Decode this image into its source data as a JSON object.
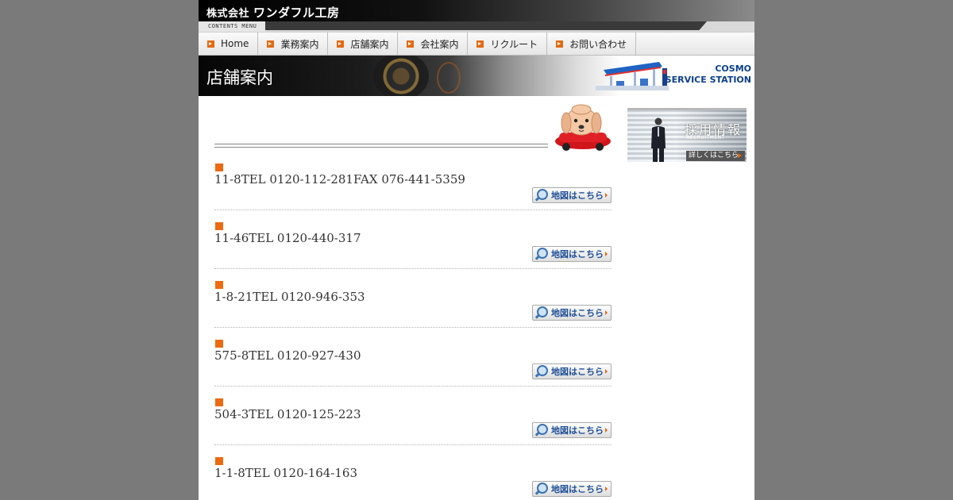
{
  "brand": {
    "prefix": "株式会社",
    "name": "ワンダフル工房"
  },
  "menu_strip_label": "CONTENTS MENU",
  "nav": [
    {
      "label": "Home"
    },
    {
      "label": "業務案内"
    },
    {
      "label": "店舗案内"
    },
    {
      "label": "会社案内"
    },
    {
      "label": "リクルート"
    },
    {
      "label": "お問い合わせ"
    }
  ],
  "page_title": "店舗案内",
  "station_logo": {
    "line1": "COSMO",
    "line2": "SERVICE STATION"
  },
  "stores": [
    {
      "info": "11-8TEL 0120-112-281FAX 076-441-5359",
      "map_label": "地図はこちら"
    },
    {
      "info": "11-46TEL 0120-440-317",
      "map_label": "地図はこちら"
    },
    {
      "info": "1-8-21TEL 0120-946-353",
      "map_label": "地図はこちら"
    },
    {
      "info": "575-8TEL 0120-927-430",
      "map_label": "地図はこちら"
    },
    {
      "info": "504-3TEL 0120-125-223",
      "map_label": "地図はこちら"
    },
    {
      "info": "1-1-8TEL 0120-164-163",
      "map_label": "地図はこちら"
    }
  ],
  "recruit_banner": {
    "title": "採用情報",
    "subtitle": "RECRUITMENT",
    "more": "詳しくはこちら"
  },
  "colors": {
    "accent": "#ee6a10",
    "link_blue": "#1e4f96",
    "page_bg": "#7a7a7a"
  }
}
